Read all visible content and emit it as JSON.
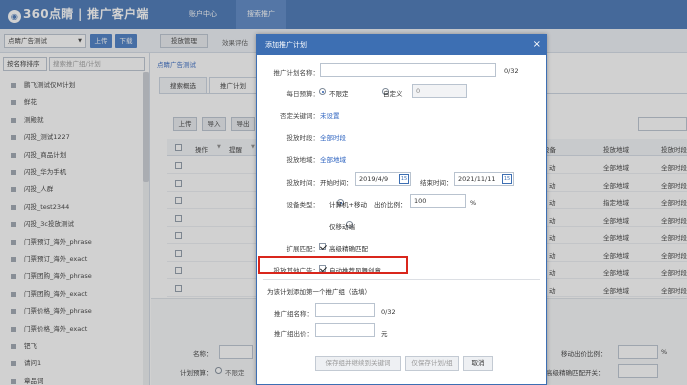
{
  "header": {
    "logo_mark": "◉",
    "logo_text": "360点睛 | 推广客户端",
    "nav": [
      {
        "label": "账户中心"
      },
      {
        "label": "搜索推广"
      }
    ]
  },
  "toolbar": {
    "account_select": "点睛广告测试",
    "upload_label": "上传",
    "download_label": "下载",
    "manage_label": "投放管理",
    "effect_label": "效果评估"
  },
  "sidebar": {
    "sort_label": "按名称排序",
    "search_placeholder": "搜索推广组/计划",
    "items": [
      {
        "label": "鹏飞测试仅M计划"
      },
      {
        "label": "鲜花"
      },
      {
        "label": "测殿就"
      },
      {
        "label": "闪投_测试1227"
      },
      {
        "label": "闪投_商品计划"
      },
      {
        "label": "闪投_华为手机"
      },
      {
        "label": "闪投_人群"
      },
      {
        "label": "闪投_test2344"
      },
      {
        "label": "闪投_3c投放测试"
      },
      {
        "label": "门票预订_海外_phrase"
      },
      {
        "label": "门票预订_海外_exact"
      },
      {
        "label": "门票团购_海外_phrase"
      },
      {
        "label": "门票团购_海外_exact"
      },
      {
        "label": "门票价格_海外_phrase"
      },
      {
        "label": "门票价格_海外_exact"
      },
      {
        "label": "钯飞"
      },
      {
        "label": "请问1"
      },
      {
        "label": "章品词"
      }
    ]
  },
  "main": {
    "breadcrumb": "点睛广告测试",
    "tabs": [
      {
        "label": "搜索概选"
      },
      {
        "label": "推广计划"
      }
    ],
    "actions": {
      "upload": "上传",
      "import": "导入",
      "export": "导出"
    },
    "table_headers_left": [
      "操作",
      "提醒"
    ],
    "table_headers_right": [
      "设备",
      "投放地域",
      "投放时段"
    ],
    "rows": [
      {
        "device": "动",
        "region": "全部地域",
        "time": "全部时段"
      },
      {
        "device": "动",
        "region": "全部地域",
        "time": "全部时段"
      },
      {
        "device": "动",
        "region": "指定地域",
        "time": "全部时段"
      },
      {
        "device": "动",
        "region": "全部地域",
        "time": "全部时段"
      },
      {
        "device": "动",
        "region": "全部地域",
        "time": "全部时段"
      },
      {
        "device": "动",
        "region": "全部地域",
        "time": "全部时段"
      },
      {
        "device": "动",
        "region": "全部地域",
        "time": "全部时段"
      },
      {
        "device": "动",
        "region": "全部地域",
        "time": "全部时段"
      },
      {
        "device": "动",
        "region": "全部地域",
        "time": "全部时段"
      },
      {
        "device": "动",
        "region": "全部地域",
        "time": "全部时段"
      }
    ],
    "form": {
      "name_label": "名称：",
      "budget_label": "计划预算：",
      "budget_option": "不限定",
      "mobile_ratio_label": "移动出价比例：",
      "mobile_ratio_unit": "%",
      "exact_label": "高级精确匹配开关："
    }
  },
  "dialog": {
    "title": "添加推广计划",
    "close": "×",
    "plan_name_label": "推广计划名称：",
    "plan_name_value": "",
    "plan_name_counter": "0/32",
    "budget_label": "每日预算：",
    "budget_unlimited": "不限定",
    "budget_custom": "自定义",
    "budget_value": "0",
    "neg_kw_label": "否定关键词：",
    "neg_kw_link": "未设置",
    "time_label": "投放时段：",
    "time_link": "全部时段",
    "region_label": "投放地域：",
    "region_link": "全部地域",
    "date_label": "投放时间：",
    "start_label": "开始时间：",
    "start_value": "2019/4/9",
    "end_label": "结束时间：",
    "end_value": "2021/11/11",
    "device_label": "设备类型：",
    "device_pc_mobile": "计算机+移动",
    "ratio_label": "出价比例：",
    "ratio_value": "100",
    "ratio_unit": "%",
    "device_mobile_only": "仅移动端",
    "match_label": "扩展匹配：",
    "match_option": "高级精确匹配",
    "other_ads_label": "投放其他广告：",
    "other_ads_option": "自动推荐风舞创意",
    "group_hint": "为该计划添加第一个推广组（选填）",
    "group_name_label": "推广组名称：",
    "group_name_counter": "0/32",
    "group_bid_label": "推广组出价：",
    "group_bid_unit": "元",
    "btn_save_add_kw": "保存组并继续到关键词",
    "btn_save_only": "仅保存计划/组",
    "btn_cancel": "取消"
  }
}
